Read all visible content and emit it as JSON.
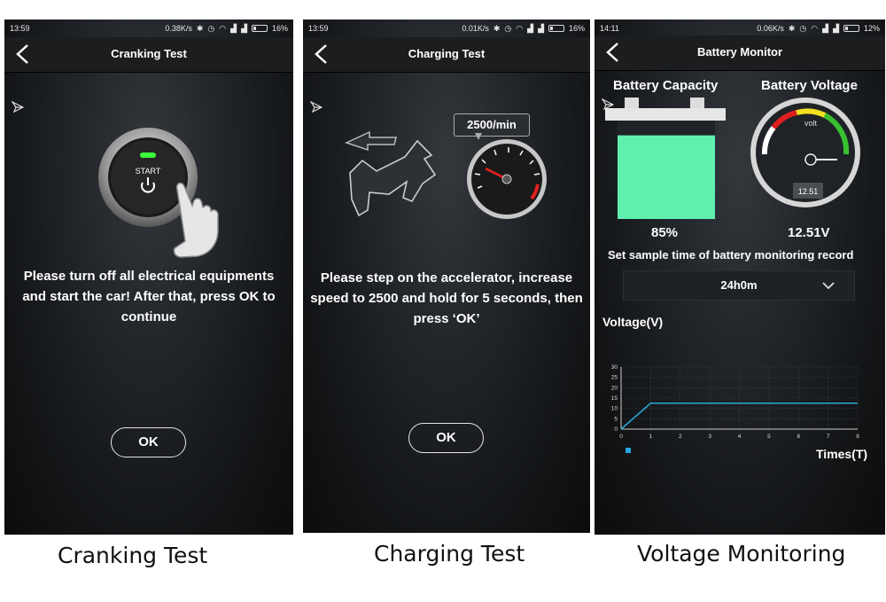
{
  "screens": [
    {
      "status": {
        "time": "13:59",
        "speed": "0.38K/s",
        "battery": "16%"
      },
      "title": "Cranking Test",
      "button_label": "START",
      "message": "Please turn off all electrical equipments and start the car! After that, press OK to continue",
      "ok_label": "OK"
    },
    {
      "status": {
        "time": "13:59",
        "speed": "0.01K/s",
        "battery": "16%"
      },
      "title": "Charging Test",
      "rpm_label": "2500/min",
      "message": "Please step on the accelerator, increase speed to 2500 and hold for 5 seconds, then press ‘OK’",
      "ok_label": "OK"
    },
    {
      "status": {
        "time": "14:11",
        "speed": "0.06K/s",
        "battery": "12%"
      },
      "title": "Battery Monitor",
      "capacity_title": "Battery Capacity",
      "voltage_title": "Battery Voltage",
      "capacity_value": "85%",
      "capacity_fraction": 0.85,
      "gauge_unit": "volt",
      "gauge_readout": "12.51",
      "voltage_value": "12.51V",
      "sample_label": "Set sample time of battery monitoring record",
      "sample_value": "24h0m",
      "chart_ylabel": "Voltage(V)",
      "chart_xlabel": "Times(T)"
    }
  ],
  "captions": [
    "Cranking Test",
    "Charging Test",
    "Voltage Monitoring"
  ],
  "colors": {
    "line": "#2aa9d8",
    "battery": "#5ff0b0",
    "legend": "#27a4e0"
  },
  "chart_data": {
    "type": "line",
    "x": [
      0,
      1,
      2,
      3,
      4,
      5,
      6,
      7,
      8
    ],
    "series": [
      {
        "values": [
          0,
          12.51,
          12.51,
          12.51,
          12.51,
          12.51,
          12.51,
          12.51,
          12.51
        ]
      }
    ],
    "xlabel": "Times(T)",
    "ylabel": "Voltage(V)",
    "xlim": [
      0,
      8
    ],
    "ylim": [
      0,
      30
    ],
    "yticks": [
      0,
      5,
      10,
      15,
      20,
      25,
      30
    ],
    "xticks": [
      0,
      1,
      2,
      3,
      4,
      5,
      6,
      7,
      8
    ],
    "grid": true
  }
}
